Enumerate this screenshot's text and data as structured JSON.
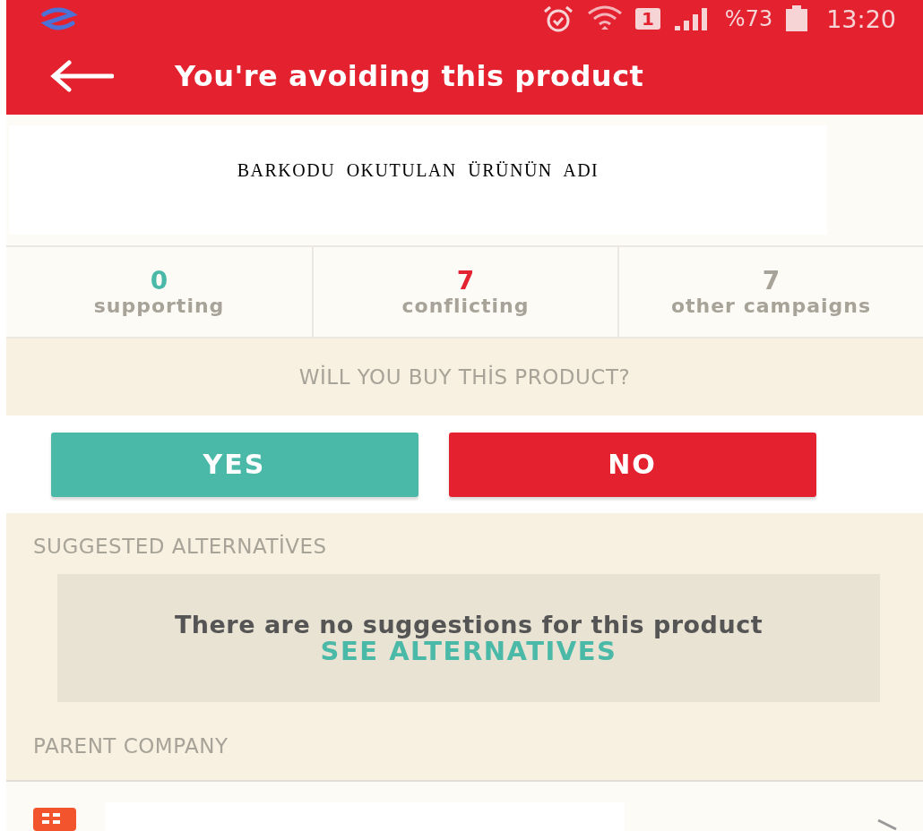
{
  "status_bar": {
    "sim": "1",
    "battery": "%73",
    "time": "13:20"
  },
  "app_bar": {
    "title": "You're avoiding this product"
  },
  "product": {
    "name": "BARKODU OKUTULAN ÜRÜNÜN ADI"
  },
  "stats": [
    {
      "value": "0",
      "label": "supporting",
      "color": "#4ab9a8"
    },
    {
      "value": "7",
      "label": "conflicting",
      "color": "#e32232"
    },
    {
      "value": "7",
      "label": "other campaigns",
      "color": "#a8a398"
    }
  ],
  "question": "WİLL YOU BUY THİS PRODUCT?",
  "buttons": [
    {
      "label": "YES",
      "kind": "yes"
    },
    {
      "label": "NO",
      "kind": "no"
    }
  ],
  "alternatives": {
    "heading": "SUGGESTED ALTERNATİVES",
    "message": "There are no suggestions for this product",
    "link": "SEE ALTERNATIVES"
  },
  "parent_company": {
    "heading": "PARENT COMPANY"
  }
}
